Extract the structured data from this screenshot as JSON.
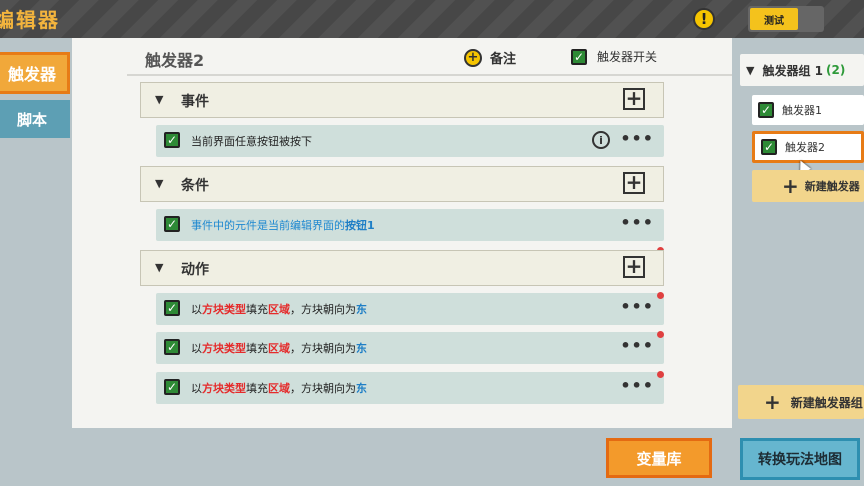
{
  "app": {
    "title": "编辑器",
    "test_label": "测试",
    "warning_icon": "exclamation-icon"
  },
  "sidebar": {
    "tabs": [
      {
        "label": "触发器"
      },
      {
        "label": "脚本"
      }
    ]
  },
  "editor": {
    "trigger_name": "触发器2",
    "note_label": "备注",
    "switch_label": "触发器开关",
    "sections": [
      {
        "label": "事件",
        "rows": [
          {
            "text": "当前界面任意按钮被按下"
          }
        ]
      },
      {
        "label": "条件",
        "rows": [
          {
            "parts": [
              "事件中的元件是当前编辑界面的",
              "按钮1"
            ]
          }
        ]
      },
      {
        "label": "动作",
        "rows": [
          {
            "parts": [
              "以",
              "方块类型",
              "填充",
              "区域",
              "，方块朝向为",
              "东"
            ]
          },
          {
            "parts": [
              "以",
              "方块类型",
              "填充",
              "区域",
              "，方块朝向为",
              "东"
            ]
          },
          {
            "parts": [
              "以",
              "方块类型",
              "填充",
              "区域",
              "，方块朝向为",
              "东"
            ]
          }
        ]
      }
    ],
    "more_glyph": "•••",
    "info_glyph": "i",
    "add_glyph": "+"
  },
  "right_panel": {
    "group_name": "触发器组 1",
    "group_count": "(2)",
    "triggers": [
      {
        "label": "触发器1"
      },
      {
        "label": "触发器2"
      }
    ],
    "new_trigger": "新建触发器",
    "new_group": "新建触发器组"
  },
  "bottom": {
    "variables": "变量库",
    "convert": "转换玩法地图"
  },
  "colors": {
    "accent_orange": "#f39a2b",
    "highlight_red": "#e52b2b",
    "highlight_blue": "#1f7fc6",
    "check_green": "#2e8a36"
  }
}
